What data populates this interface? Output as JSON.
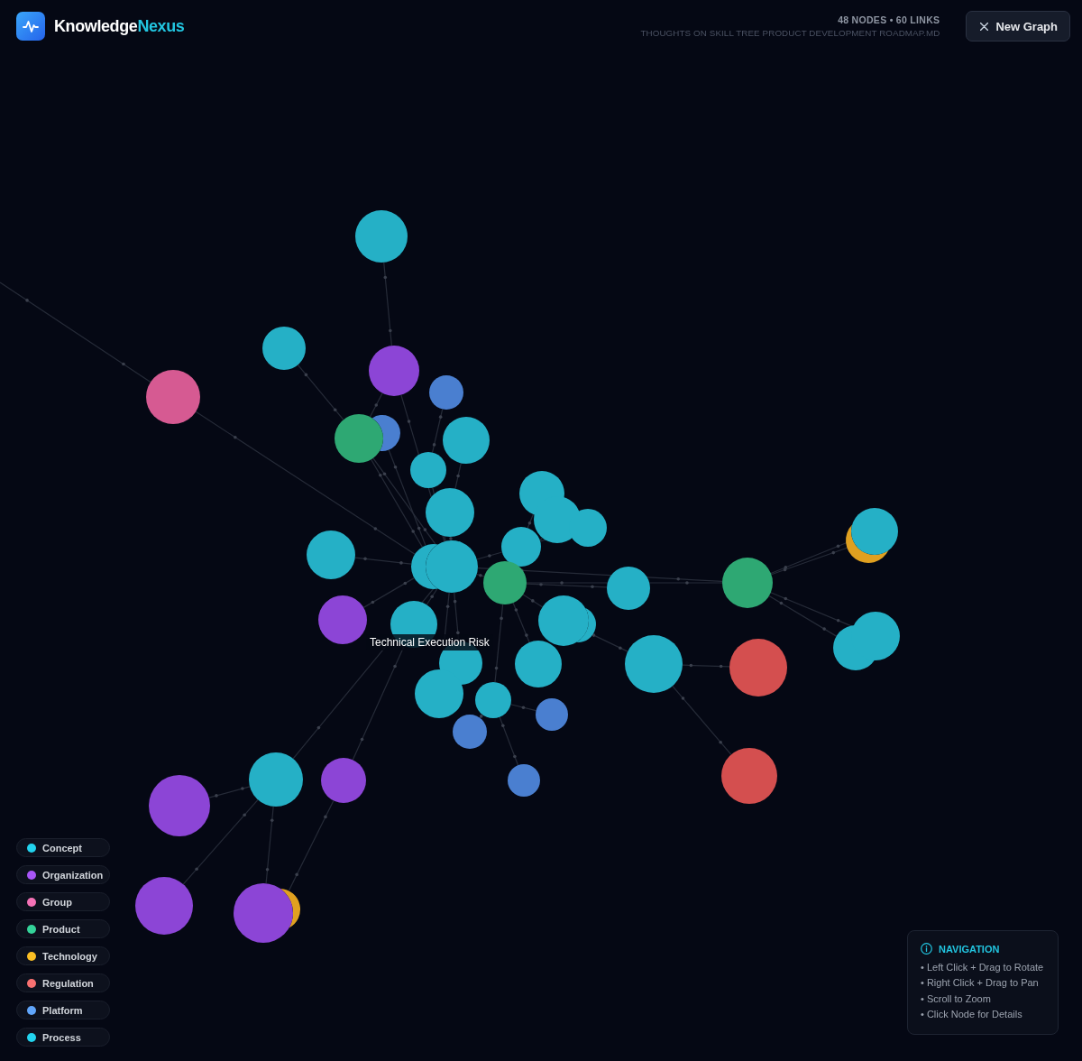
{
  "header": {
    "brand": {
      "name": "Knowledge",
      "accent": "Nexus"
    },
    "stats": "48 NODES • 60 LINKS",
    "file_name": "THOUGHTS ON SKILL TREE PRODUCT DEVELOPMENT ROADMAP.MD",
    "new_graph_button": "New Graph"
  },
  "graph": {
    "tooltip": "Technical Execution Risk",
    "nodes": [
      {
        "color": "#25b0c6"
      },
      {
        "color": "#25b0c6"
      },
      {
        "color": "#8c45d6"
      },
      {
        "color": "#d65a92"
      },
      {
        "color": "#4a7fd0"
      },
      {
        "color": "#4a7fd0"
      },
      {
        "color": "#2ea873"
      },
      {
        "color": "#25b0c6"
      },
      {
        "color": "#25b0c6"
      },
      {
        "color": "#25b0c6"
      },
      {
        "color": "#25b0c6"
      },
      {
        "color": "#25b0c6"
      },
      {
        "color": "#25b0c6"
      },
      {
        "color": "#25b0c6"
      },
      {
        "color": "#25b0c6"
      },
      {
        "color": "#25b0c6"
      },
      {
        "color": "#25b0c6"
      },
      {
        "color": "#2ea873"
      },
      {
        "color": "#25b0c6"
      },
      {
        "color": "#2ea873"
      },
      {
        "color": "#e0a020"
      },
      {
        "color": "#25b0c6"
      },
      {
        "color": "#8c45d6"
      },
      {
        "color": "#25b0c6"
      },
      {
        "color": "#25b0c6"
      },
      {
        "color": "#25b0c6"
      },
      {
        "color": "#25b0c6"
      },
      {
        "color": "#d44f4f"
      },
      {
        "color": "#25b0c6"
      },
      {
        "color": "#25b0c6"
      },
      {
        "color": "#25b0c6"
      },
      {
        "color": "#25b0c6"
      },
      {
        "color": "#25b0c6"
      },
      {
        "color": "#25b0c6"
      },
      {
        "color": "#4a7fd0"
      },
      {
        "color": "#4a7fd0"
      },
      {
        "color": "#4a7fd0"
      },
      {
        "color": "#d44f4f"
      },
      {
        "color": "#25b0c6"
      },
      {
        "color": "#8c45d6"
      },
      {
        "color": "#8c45d6"
      },
      {
        "color": "#8c45d6"
      },
      {
        "color": "#e0a020"
      },
      {
        "color": "#8c45d6"
      }
    ]
  },
  "legend": [
    {
      "label": "Concept",
      "color": "#22d3ee"
    },
    {
      "label": "Organization",
      "color": "#a855f7"
    },
    {
      "label": "Group",
      "color": "#f472b6"
    },
    {
      "label": "Product",
      "color": "#34d399"
    },
    {
      "label": "Technology",
      "color": "#fbbf24"
    },
    {
      "label": "Regulation",
      "color": "#f87171"
    },
    {
      "label": "Platform",
      "color": "#60a5fa"
    },
    {
      "label": "Process",
      "color": "#22d3ee"
    }
  ],
  "navigation": {
    "title": "NAVIGATION",
    "tips": [
      "• Left Click + Drag to Rotate",
      "• Right Click + Drag to Pan",
      "• Scroll to Zoom",
      "• Click Node for Details"
    ]
  }
}
